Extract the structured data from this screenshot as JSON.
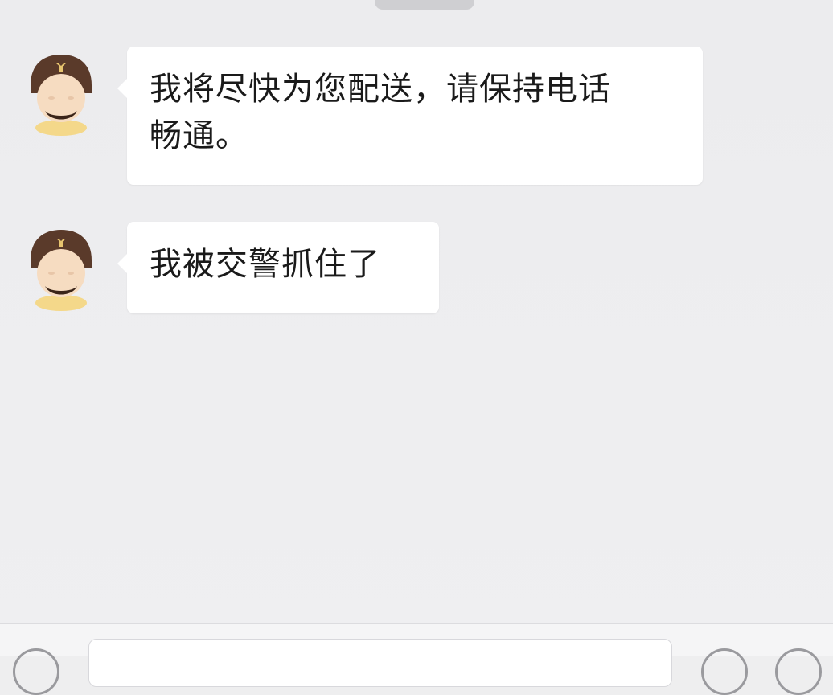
{
  "chat": {
    "messages": [
      {
        "sender": "courier",
        "avatar_icon": "courier-avatar-icon",
        "text": "我将尽快为您配送，请保持电话畅通。",
        "lines": [
          "我将尽快为您配送，请保持电话",
          "畅通。"
        ]
      },
      {
        "sender": "courier",
        "avatar_icon": "courier-avatar-icon",
        "text": "我被交警抓住了",
        "lines": [
          "我被交警抓住了"
        ]
      }
    ]
  },
  "input_bar": {
    "placeholder": "",
    "voice_icon": "voice-icon",
    "emoji_icon": "emoji-icon",
    "more_icon": "plus-icon"
  },
  "colors": {
    "background": "#eeeeef",
    "bubble": "#ffffff",
    "text": "#1a1a1a",
    "helmet": "#5a3a2a",
    "collar": "#f4d88a"
  }
}
